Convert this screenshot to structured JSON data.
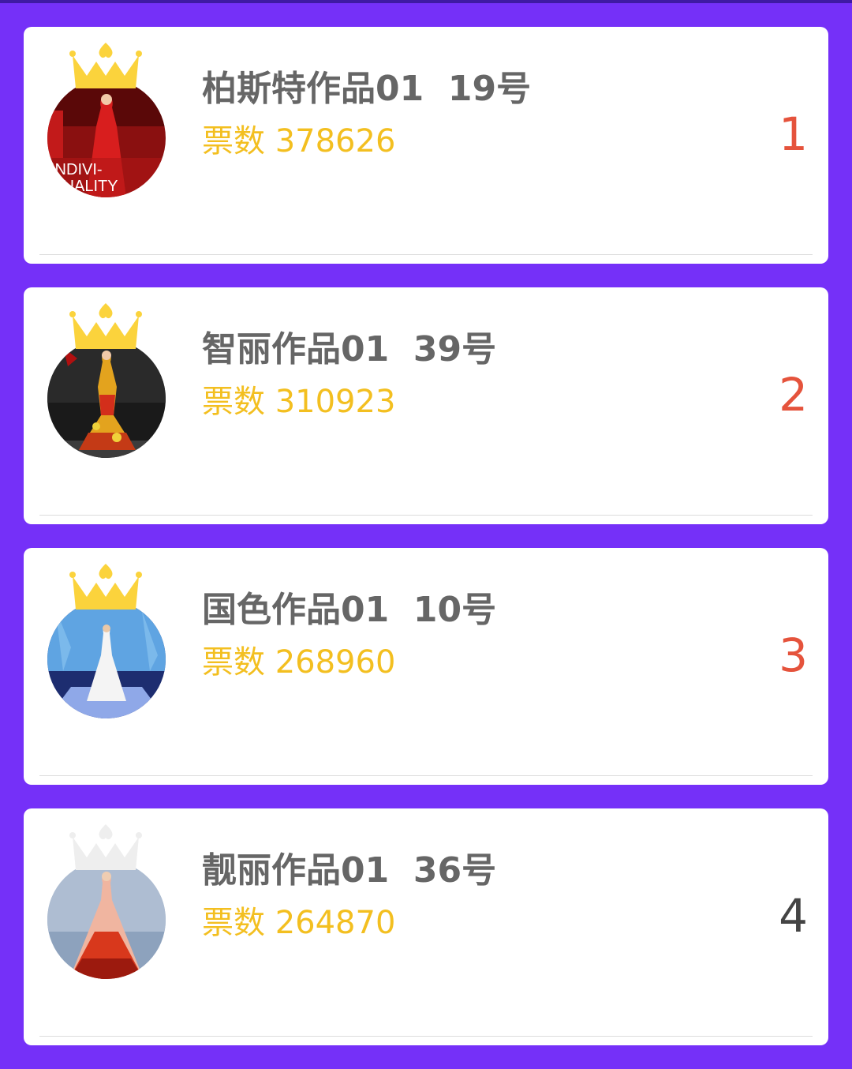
{
  "colors": {
    "background": "#7530f8",
    "card": "#ffffff",
    "title": "#666666",
    "votes": "#f3bf20",
    "rank_top": "#e5533c",
    "rank_other": "#444444",
    "crown_gold": "#fbd33c",
    "crown_silver": "#eeeeee"
  },
  "entries": [
    {
      "title": "柏斯特作品01  19号",
      "votes_label": "票数 378626",
      "rank": "1",
      "crown": "gold-crown-icon",
      "avatar_caption": "INDIVI-\nQUALITY"
    },
    {
      "title": "智丽作品01  39号",
      "votes_label": "票数 310923",
      "rank": "2",
      "crown": "gold-crown-icon"
    },
    {
      "title": "国色作品01  10号",
      "votes_label": "票数 268960",
      "rank": "3",
      "crown": "gold-crown-icon"
    },
    {
      "title": "靓丽作品01  36号",
      "votes_label": "票数 264870",
      "rank": "4",
      "crown": "silver-crown-icon"
    }
  ]
}
